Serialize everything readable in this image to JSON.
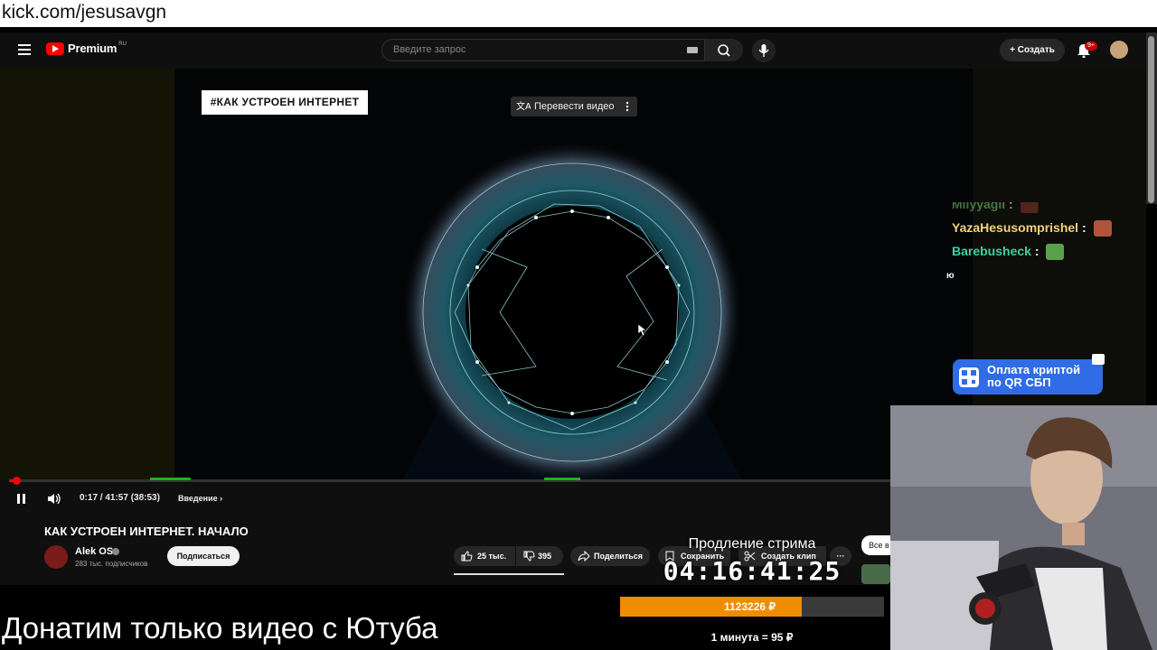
{
  "overlay": {
    "url": "kick.com/jesusavgn",
    "caption": "Донатим только видео с Ютуба",
    "stream_extension_label": "Продление стрима",
    "stream_timer": "04:16:41:25",
    "donation_amount": "1123226 ₽",
    "donation_progress": 0.69,
    "donation_rate": "1 минута = 95 ₽",
    "qr_banner": {
      "line1": "Оплата криптой",
      "line2": "по QR СБП"
    }
  },
  "youtube": {
    "logo_text": "Premium",
    "logo_region": "RU",
    "search_placeholder": "Введите запрос",
    "create_label": "Создать",
    "notifications_badge": "9+",
    "video_overlay_tag": "#КАК УСТРОЕН ИНТЕРНЕТ",
    "translate_label": "Перевести видео",
    "time": "0:17 / 41:57 (38:53)",
    "chapter": "Введение",
    "title": "КАК УСТРОЕН ИНТЕРНЕТ. НАЧАЛО",
    "channel_name": "Alek OS",
    "subscribers": "283 тыс. подписчиков",
    "subscribe_label": "Подписаться",
    "likes": "25 тыс.",
    "dislikes": "395",
    "share_label": "Поделиться",
    "save_label": "Сохранить",
    "clip_label": "Создать клип",
    "more_label": "···",
    "all_videos_label": "Все в"
  },
  "chat": {
    "messages": [
      {
        "user": "Miiyyagii",
        "color": "#7ec86f"
      },
      {
        "user": "YazaHesusomprishel",
        "color": "#f2d37a"
      },
      {
        "user": "Barebusheck",
        "color": "#3fd0a2"
      }
    ],
    "separator": " :",
    "stray_char": "ю"
  },
  "colors": {
    "youtube_red": "#ff0000",
    "donation_orange": "#f08c00",
    "progress_green": "#1db31d",
    "qr_blue": "#2f6ce6"
  }
}
